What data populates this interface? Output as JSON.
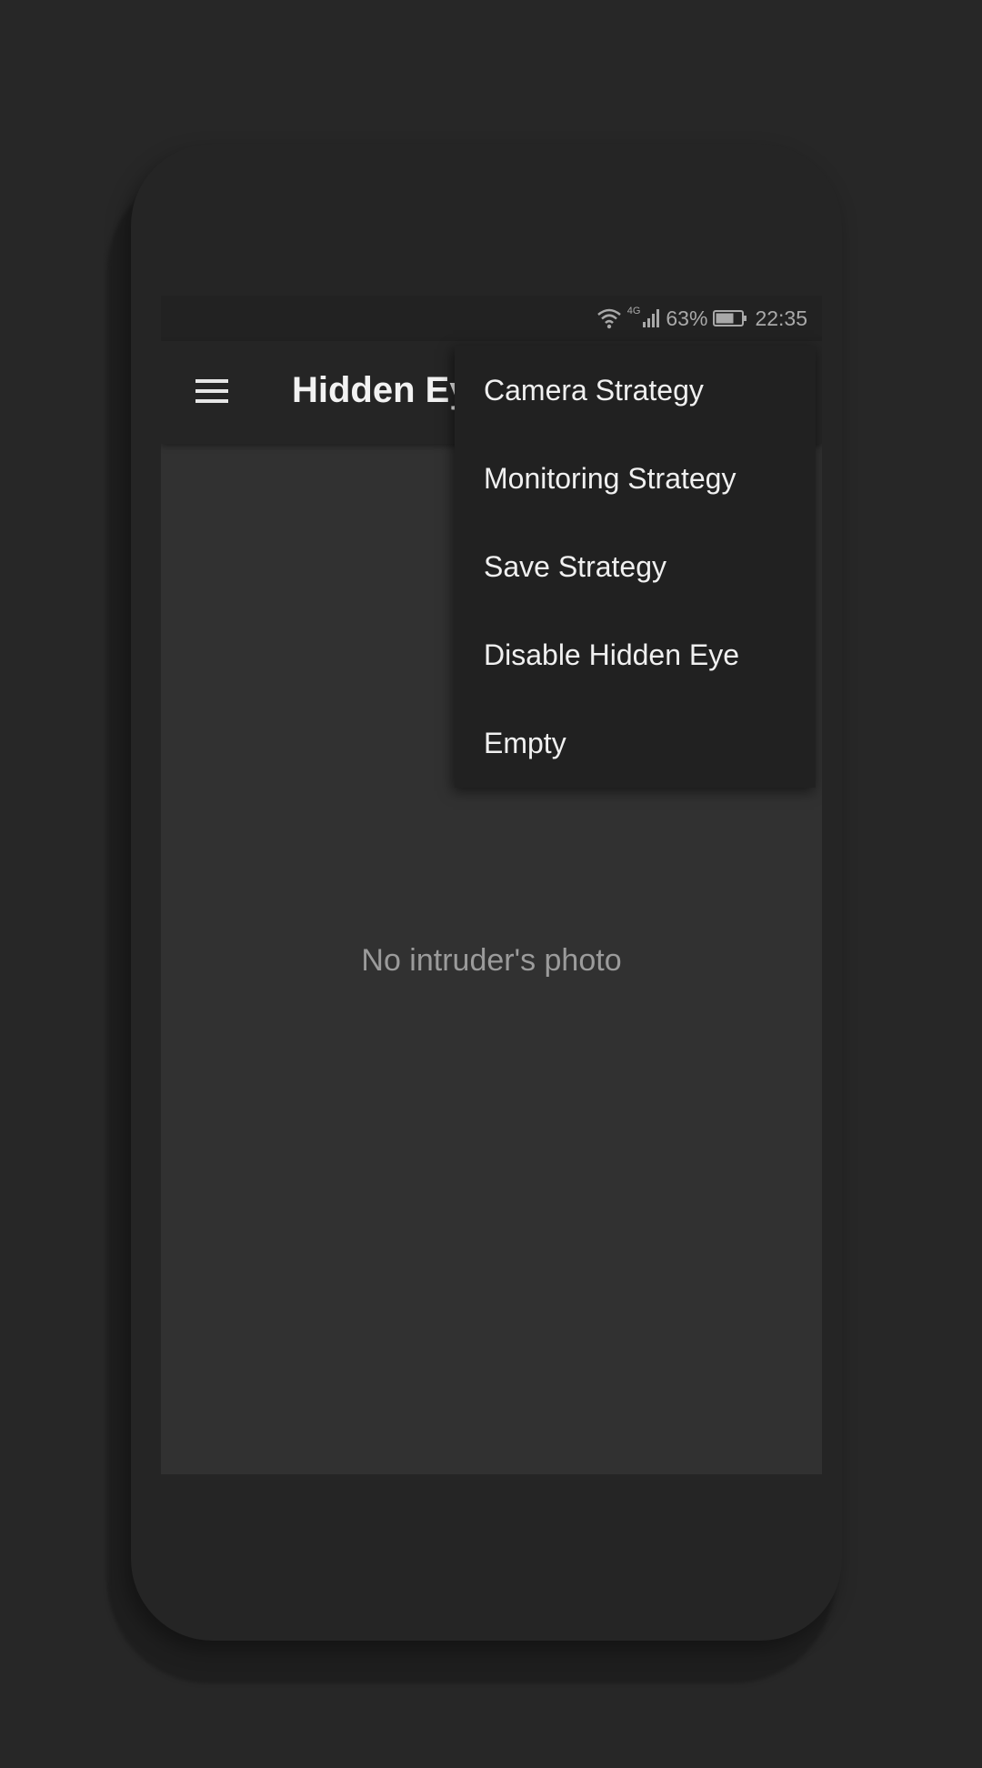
{
  "status_bar": {
    "network_type": "4G",
    "battery_percent": "63%",
    "time": "22:35",
    "icons": [
      "wifi-icon",
      "signal-icon",
      "battery-icon"
    ]
  },
  "app_bar": {
    "title": "Hidden Eye",
    "menu_icon": "hamburger-menu-icon"
  },
  "overflow_menu": {
    "items": [
      {
        "label": "Camera Strategy"
      },
      {
        "label": "Monitoring Strategy"
      },
      {
        "label": "Save Strategy"
      },
      {
        "label": "Disable Hidden Eye"
      },
      {
        "label": "Empty"
      }
    ]
  },
  "main": {
    "empty_message": "No intruder's photo"
  },
  "colors": {
    "background": "#272727",
    "screen": "#313131",
    "app_bar": "#252525",
    "menu": "#212121",
    "text_primary": "#f0f0f0",
    "text_secondary": "#9b9b9b"
  }
}
